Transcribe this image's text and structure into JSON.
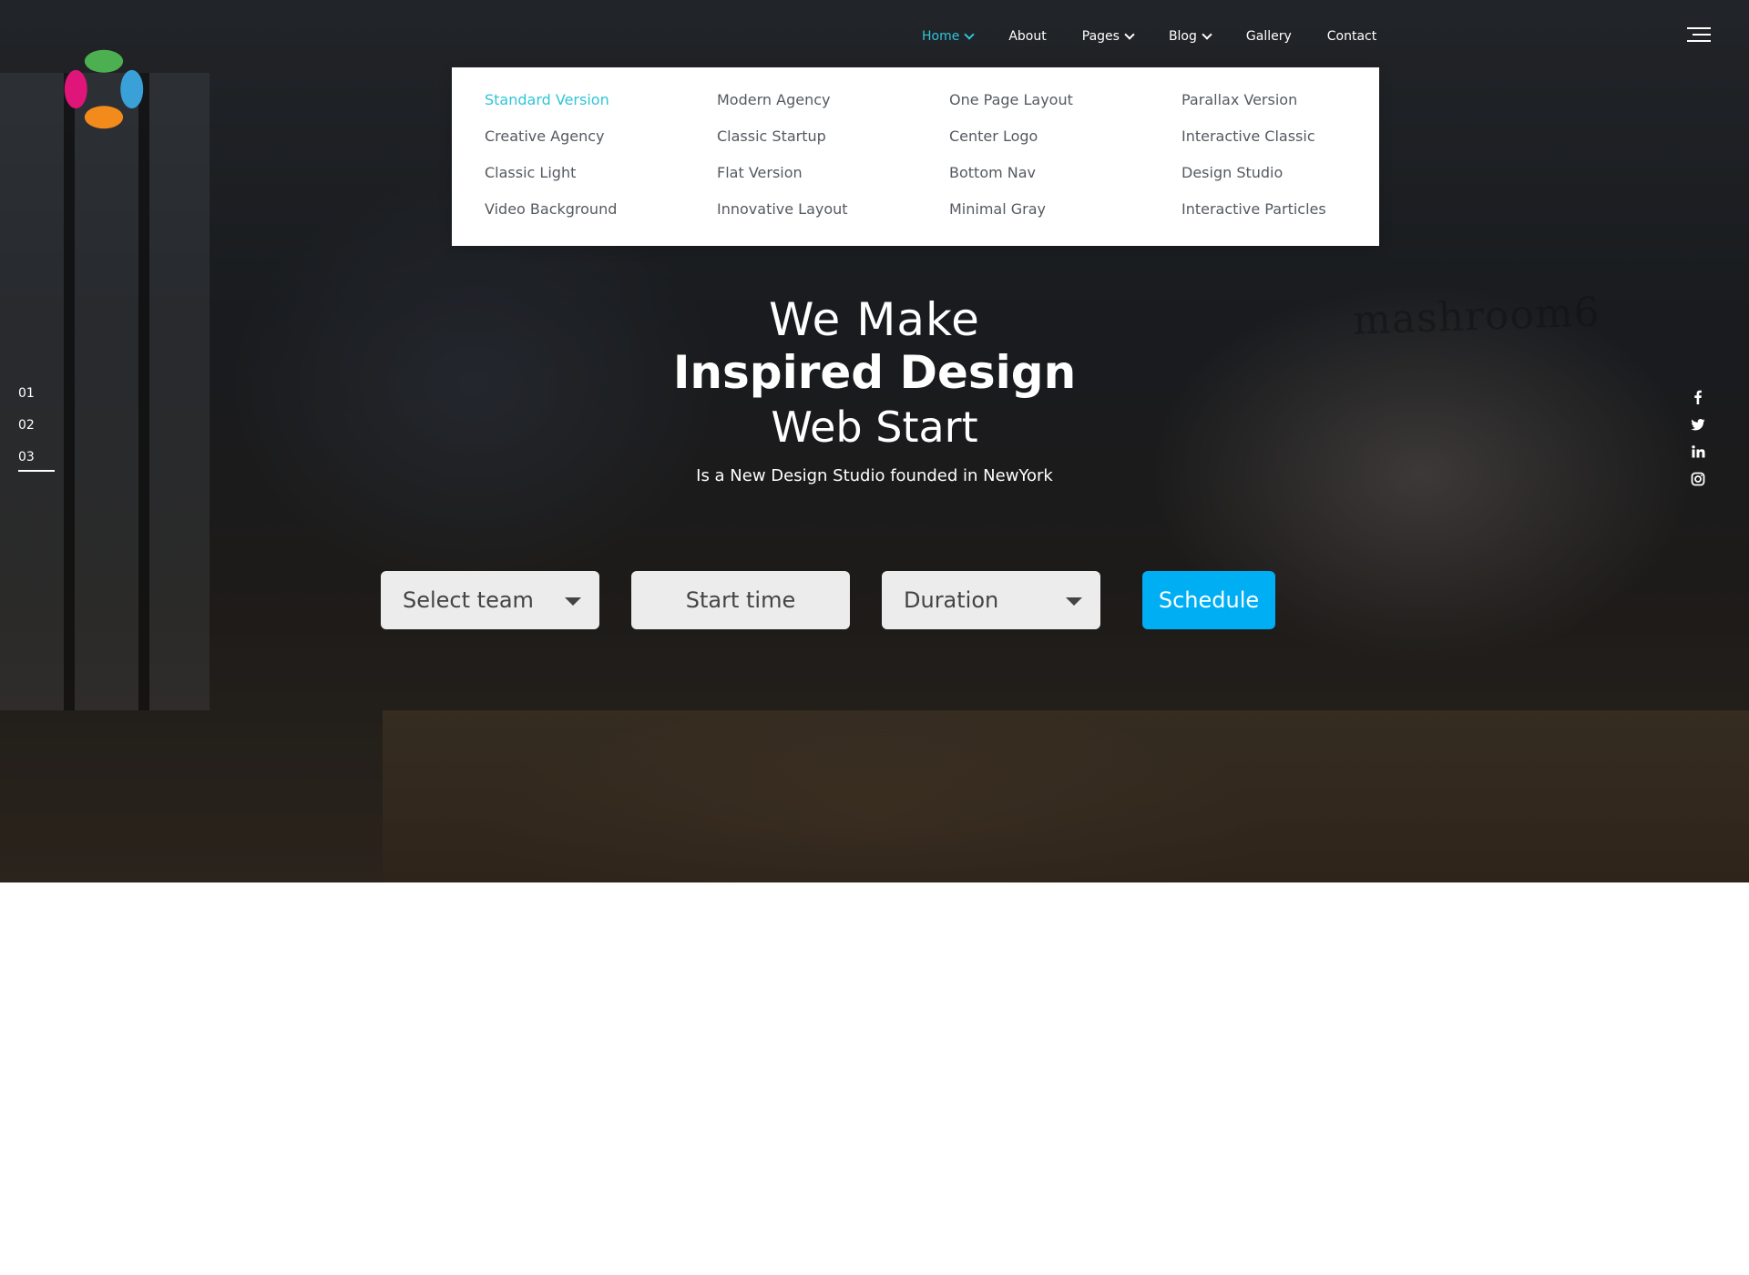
{
  "nav": {
    "items": [
      {
        "label": "Home",
        "has_dropdown": true,
        "active": true
      },
      {
        "label": "About",
        "has_dropdown": false,
        "active": false
      },
      {
        "label": "Pages",
        "has_dropdown": true,
        "active": false
      },
      {
        "label": "Blog",
        "has_dropdown": true,
        "active": false
      },
      {
        "label": "Gallery",
        "has_dropdown": false,
        "active": false
      },
      {
        "label": "Contact",
        "has_dropdown": false,
        "active": false
      }
    ]
  },
  "mega_menu": {
    "columns": [
      [
        "Standard Version",
        "Creative Agency",
        "Classic Light",
        "Video Background"
      ],
      [
        "Modern Agency",
        "Classic Startup",
        "Flat Version",
        "Innovative Layout"
      ],
      [
        "One Page Layout",
        "Center Logo",
        "Bottom Nav",
        "Minimal Gray"
      ],
      [
        "Parallax Version",
        "Interactive Classic",
        "Design Studio",
        "Interactive Particles"
      ]
    ],
    "active_item": "Standard Version"
  },
  "hero": {
    "line1": "We Make",
    "line2": "Inspired Design",
    "line3": "Web Start",
    "subtitle": "Is a New Design Studio founded in NewYork",
    "background_sign": "mashroom6"
  },
  "slides": {
    "numbers": [
      "01",
      "02",
      "03"
    ],
    "active": "03"
  },
  "social": {
    "icons": [
      "facebook-icon",
      "twitter-icon",
      "linkedin-icon",
      "instagram-icon"
    ]
  },
  "form": {
    "team_select": "Select team",
    "start_time": "Start time",
    "duration_select": "Duration",
    "schedule_button": "Schedule"
  },
  "colors": {
    "accent": "#2fc5d9",
    "button": "#00aef4",
    "menu_text": "#555a60",
    "field_bg": "#ececec"
  }
}
